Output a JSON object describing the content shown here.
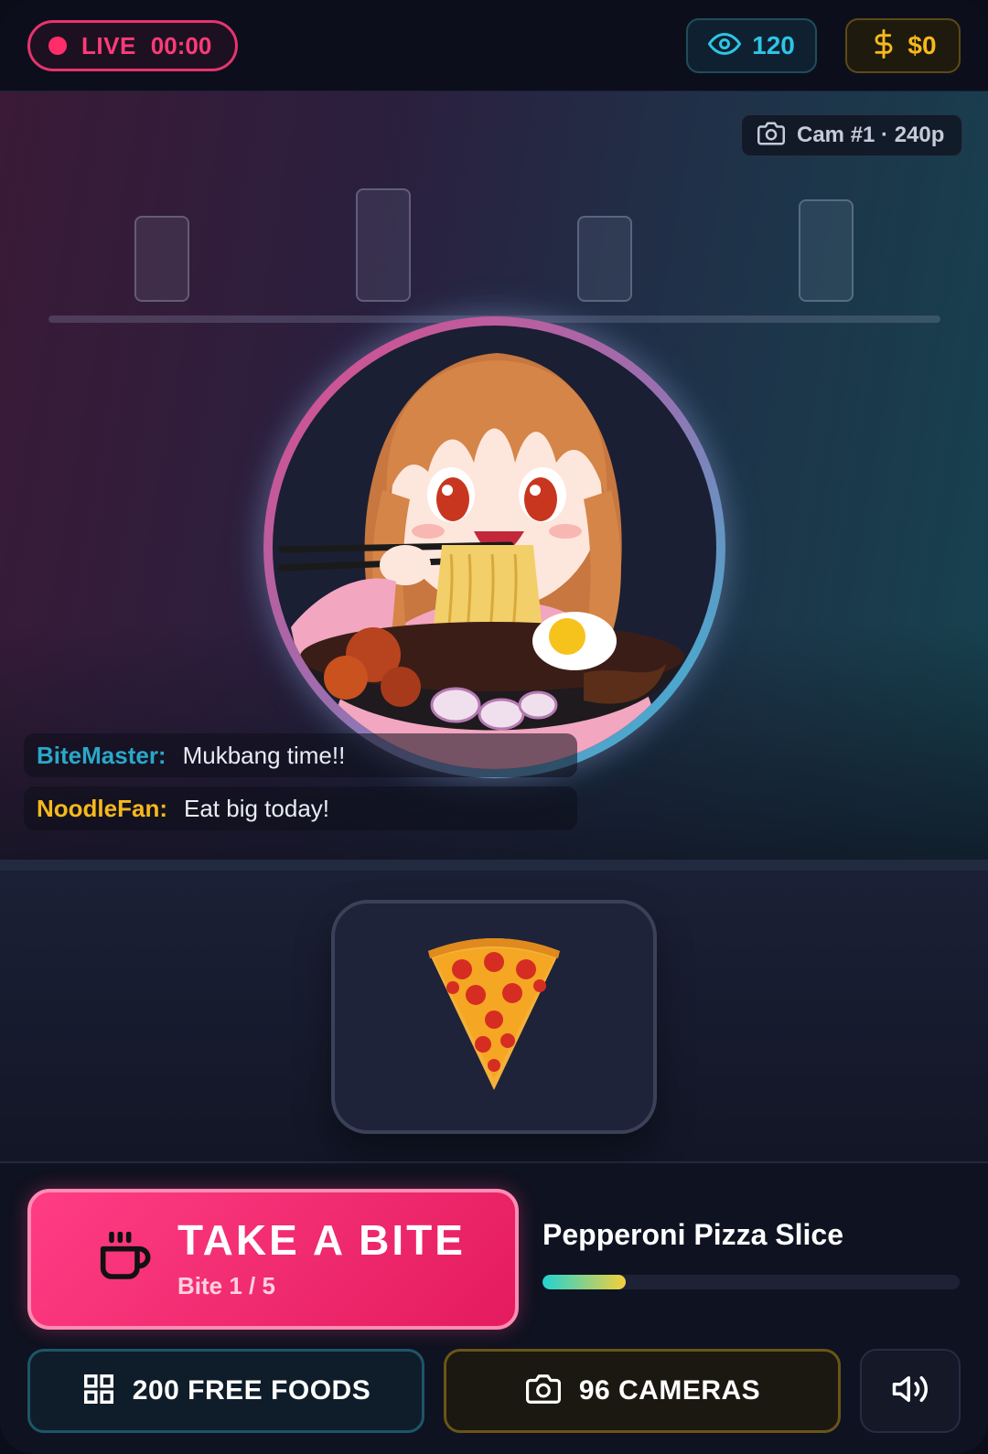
{
  "status": {
    "live_label": "LIVE",
    "timer": "00:00",
    "live_color": "#ff2d6a"
  },
  "stats": {
    "viewers": "120",
    "money": "$0"
  },
  "camera_badge": "Cam #1 · 240p",
  "chat": [
    {
      "user": "BiteMaster:",
      "message": "Mukbang time!!",
      "color": "#2aa8c8"
    },
    {
      "user": "NoodleFan:",
      "message": "Eat big today!",
      "color": "#f6b81c"
    }
  ],
  "current_food": {
    "name": "Pepperoni Pizza Slice",
    "progress_fraction": 0.2
  },
  "bite_button": {
    "title": "TAKE A BITE",
    "subtitle": "Bite 1 / 5"
  },
  "bottom_buttons": {
    "foods": "200 FREE FOODS",
    "cameras": "96 CAMERAS"
  },
  "icons": [
    "eye-icon",
    "dollar-icon",
    "camera-icon",
    "coffee-cup-icon",
    "grid-icon",
    "speaker-icon"
  ],
  "colors": {
    "accent_pink": "#ff3d84",
    "accent_cyan": "#2ec5e6",
    "accent_gold": "#f6b81c"
  }
}
